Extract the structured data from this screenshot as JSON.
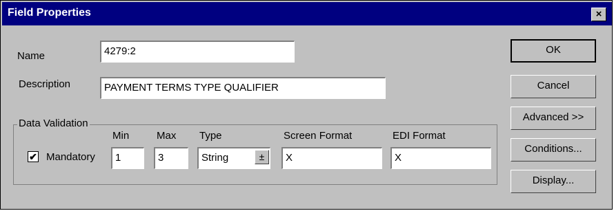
{
  "window": {
    "title": "Field Properties",
    "close_glyph": "×"
  },
  "form": {
    "name_label": "Name",
    "name_value": "4279:2",
    "description_label": "Description",
    "description_value": "PAYMENT TERMS TYPE QUALIFIER"
  },
  "data_validation": {
    "group_label": "Data Validation",
    "mandatory_label": "Mandatory",
    "mandatory_checked": true,
    "check_glyph": "✔",
    "min_label": "Min",
    "min_value": "1",
    "max_label": "Max",
    "max_value": "3",
    "type_label": "Type",
    "type_value": "String",
    "dropdown_glyph": "±",
    "screen_format_label": "Screen Format",
    "screen_format_value": "X",
    "edi_format_label": "EDI Format",
    "edi_format_value": "X"
  },
  "buttons": {
    "ok": "OK",
    "cancel": "Cancel",
    "advanced": "Advanced >>",
    "conditions": "Conditions...",
    "display": "Display..."
  },
  "colors": {
    "titlebar": "#000080",
    "dialog": "#c0c0c0",
    "field": "#ffffff"
  }
}
